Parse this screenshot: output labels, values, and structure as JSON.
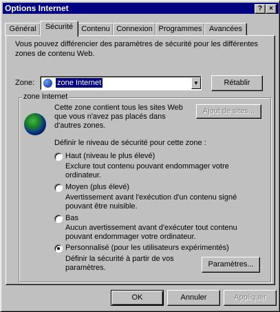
{
  "window": {
    "title": "Options Internet",
    "help_glyph": "?",
    "close_glyph": "×"
  },
  "tabs": [
    {
      "label": "Général"
    },
    {
      "label": "Sécurité"
    },
    {
      "label": "Contenu"
    },
    {
      "label": "Connexion"
    },
    {
      "label": "Programmes"
    },
    {
      "label": "Avancées"
    }
  ],
  "intro_text": "Vous pouvez différencier des paramètres de sécurité pour les différentes zones de contenu Web.",
  "zone": {
    "label": "Zone:",
    "selected": "zone Internet",
    "restore_button": "Rétablir"
  },
  "group": {
    "title": "zone Internet",
    "description": "Cette zone contient tous les sites Web que vous n'avez pas placés dans d'autres zones.",
    "add_sites_button": "Ajout de sites...",
    "level_prompt": "Définir le niveau de sécurité pour cette zone :",
    "options": [
      {
        "label": "Haut (niveau le plus élevé)",
        "desc": "Exclure tout contenu pouvant endommager votre ordinateur."
      },
      {
        "label": "Moyen (plus élevé)",
        "desc": "Avertissement avant l'exécution d'un contenu signé pouvant être nuisible."
      },
      {
        "label": "Bas",
        "desc": "Aucun avertissement avant d'exécuter tout contenu pouvant endommager votre ordinateur."
      },
      {
        "label": "Personnalisé (pour les utilisateurs expérimentés)",
        "desc": "Définir la sécurité à partir de vos paramètres.",
        "selected": true
      }
    ],
    "settings_button": "Paramètres..."
  },
  "footer": {
    "ok": "OK",
    "cancel": "Annuler",
    "apply": "Appliquer"
  }
}
